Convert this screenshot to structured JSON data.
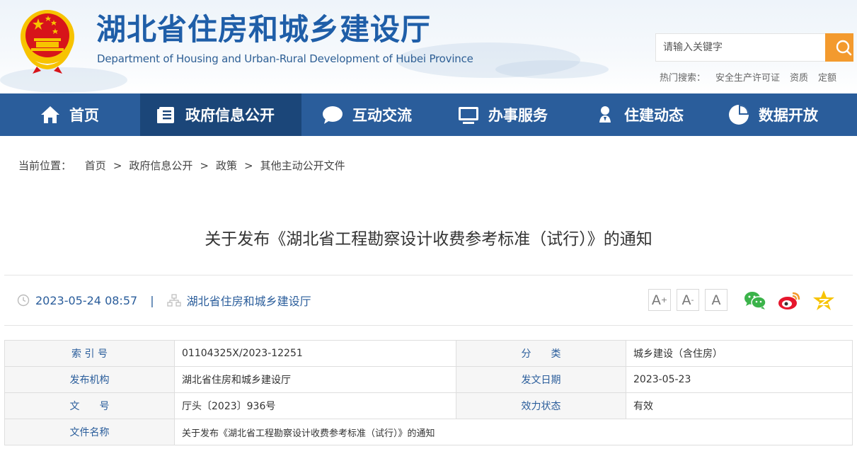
{
  "header": {
    "title": "湖北省住房和城乡建设厅",
    "subtitle": "Department of Housing and Urban-Rural Development of Hubei Province"
  },
  "search": {
    "placeholder": "请输入关键字",
    "hot_label": "热门搜索：",
    "hot_keywords": [
      "安全生产许可证",
      "资质",
      "定额"
    ]
  },
  "nav": {
    "items": [
      {
        "label": "首页",
        "icon": "home-icon"
      },
      {
        "label": "政府信息公开",
        "icon": "document-list-icon",
        "active": true
      },
      {
        "label": "互动交流",
        "icon": "chat-bubble-icon"
      },
      {
        "label": "办事服务",
        "icon": "monitor-icon"
      },
      {
        "label": "住建动态",
        "icon": "person-pin-icon"
      },
      {
        "label": "数据开放",
        "icon": "pie-chart-icon"
      }
    ],
    "background": "#2a5d9b",
    "active_background": "#1b4679"
  },
  "breadcrumb": {
    "label": "当前位置：",
    "items": [
      "首页",
      "政府信息公开",
      "政策",
      "其他主动公开文件"
    ],
    "separator": ">"
  },
  "article": {
    "title": "关于发布《湖北省工程勘察设计收费参考标准（试行）》的通知",
    "datetime": "2023-05-24 08:57",
    "pipe": "|",
    "source": "湖北省住房和城乡建设厅"
  },
  "font_controls": {
    "larger": "A",
    "smaller": "A",
    "default": "A",
    "larger_mark": "+",
    "smaller_mark": "-"
  },
  "share": [
    "wechat-icon",
    "weibo-icon",
    "qzone-icon"
  ],
  "info_table": {
    "rows": [
      {
        "k1": "索 引 号",
        "v1": "01104325X/2023-12251",
        "k2": "分　　类",
        "v2": "城乡建设（含住房）"
      },
      {
        "k1": "发布机构",
        "v1": "湖北省住房和城乡建设厅",
        "k2": "发文日期",
        "v2": "2023-05-23"
      },
      {
        "k1": "文　　号",
        "v1": "厅头〔2023〕936号",
        "k2": "效力状态",
        "v2": "有效"
      },
      {
        "k1": "文件名称",
        "v1": "关于发布《湖北省工程勘察设计收费参考标准（试行）》的通知"
      }
    ]
  },
  "colors": {
    "brand_blue": "#1f5ea8",
    "search_orange": "#f39a2e",
    "emblem_red": "#d7141a",
    "emblem_gold": "#f7c300"
  }
}
